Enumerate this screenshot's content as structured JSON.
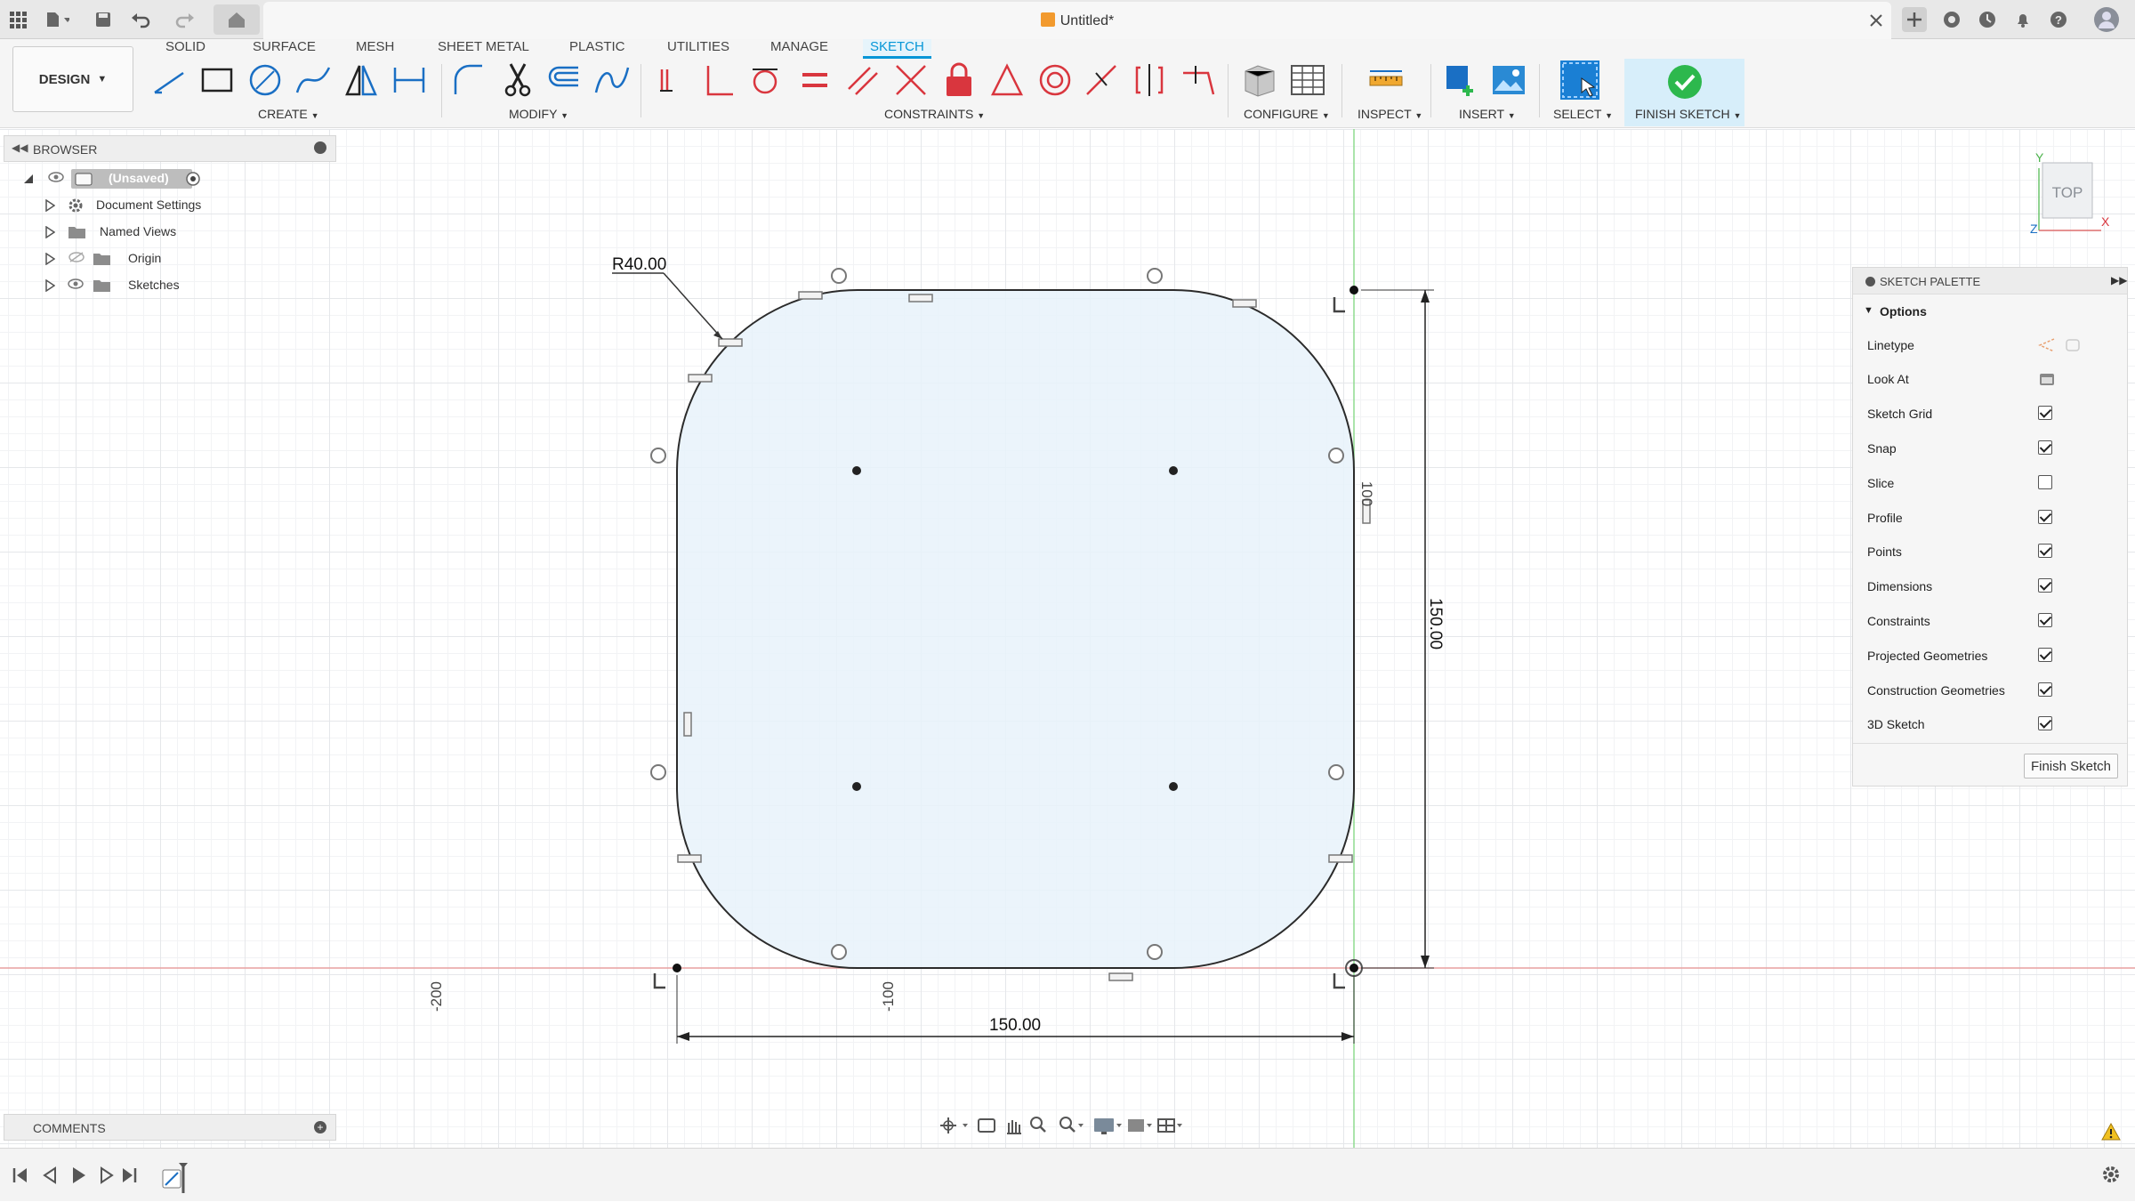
{
  "window": {
    "title": "Untitled*"
  },
  "tabs": [
    "SOLID",
    "SURFACE",
    "MESH",
    "SHEET METAL",
    "PLASTIC",
    "UTILITIES",
    "MANAGE",
    "SKETCH"
  ],
  "active_tab": "SKETCH",
  "workspace": {
    "label": "DESIGN"
  },
  "groups": {
    "create": "CREATE",
    "modify": "MODIFY",
    "constraints": "CONSTRAINTS",
    "configure": "CONFIGURE",
    "inspect": "INSPECT",
    "insert": "INSERT",
    "select": "SELECT",
    "finish": "FINISH SKETCH"
  },
  "browser": {
    "title": "BROWSER",
    "root": "(Unsaved)",
    "items": [
      "Document Settings",
      "Named Views",
      "Origin",
      "Sketches"
    ]
  },
  "comments": {
    "title": "COMMENTS"
  },
  "sketch": {
    "radius_label": "R40.00",
    "width_label": "150.00",
    "height_label": "150.00",
    "axis_label_200": "-200",
    "axis_label_100": "-100",
    "axis_label_100_v": "100",
    "fill_color": "#e8f2fa",
    "line_color": "#2b2b2b"
  },
  "view_cube": {
    "face": "TOP",
    "axis_x": "X",
    "axis_y": "Y",
    "axis_z": "Z"
  },
  "palette": {
    "title": "SKETCH PALETTE",
    "section": "Options",
    "rows": [
      {
        "label": "Linetype",
        "control": "icons"
      },
      {
        "label": "Look At",
        "control": "icon"
      },
      {
        "label": "Sketch Grid",
        "checked": true
      },
      {
        "label": "Snap",
        "checked": true
      },
      {
        "label": "Slice",
        "checked": false
      },
      {
        "label": "Profile",
        "checked": true
      },
      {
        "label": "Points",
        "checked": true
      },
      {
        "label": "Dimensions",
        "checked": true
      },
      {
        "label": "Constraints",
        "checked": true
      },
      {
        "label": "Projected Geometries",
        "checked": true
      },
      {
        "label": "Construction Geometries",
        "checked": true
      },
      {
        "label": "3D Sketch",
        "checked": true
      }
    ],
    "finish_button": "Finish Sketch"
  },
  "colors": {
    "accent": "#0696d7",
    "finish_green": "#2db84d",
    "constraint_red": "#d9363e"
  }
}
